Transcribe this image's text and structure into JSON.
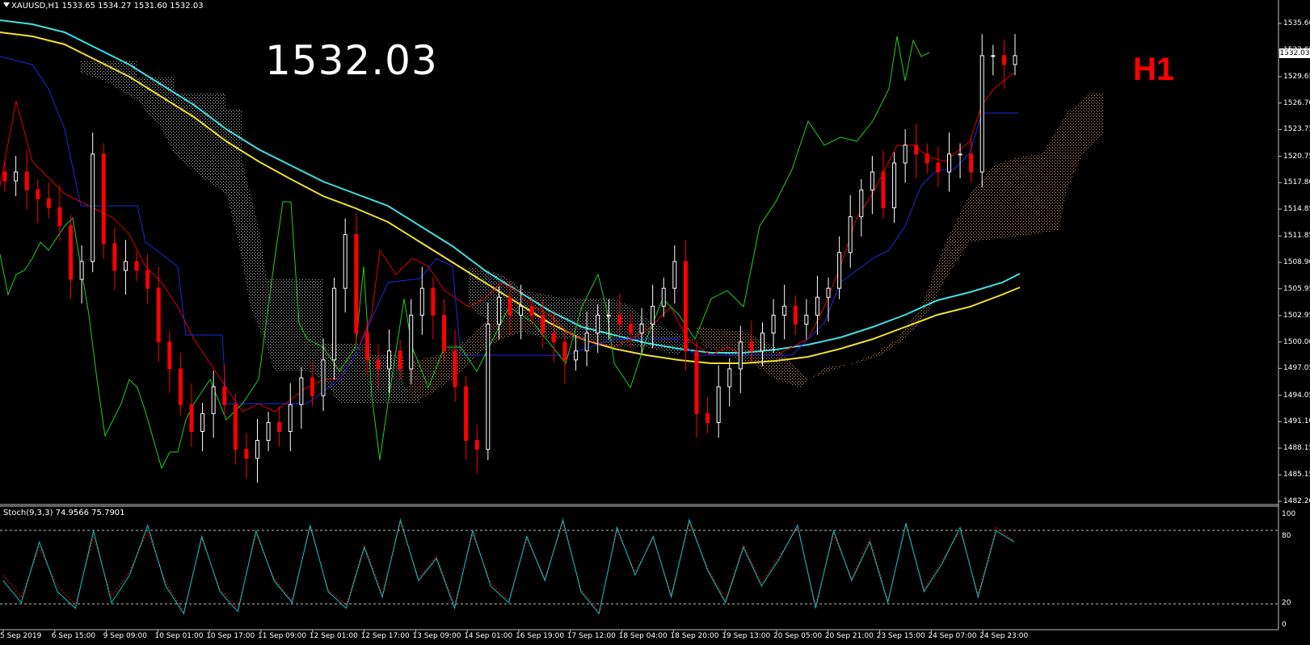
{
  "header": {
    "symbol_line": "XAUUSD,H1  1533.65 1534.27 1531.60 1532.03"
  },
  "overlay": {
    "big_price": "1532.03",
    "timeframe": "H1",
    "timeframe_color": "#ff0000"
  },
  "current_price_tag": "1532.03",
  "price_axis": {
    "labels": [
      "1535.60",
      "1532.65",
      "1529.65",
      "1526.70",
      "1523.75",
      "1520.75",
      "1517.80",
      "1514.85",
      "1511.85",
      "1508.90",
      "1505.95",
      "1502.95",
      "1500.00",
      "1497.05",
      "1494.05",
      "1491.10",
      "1488.15",
      "1485.15",
      "1482.20"
    ],
    "range": [
      1482.2,
      1535.6
    ]
  },
  "stoch": {
    "header": "Stoch(9,3,3) 74.9566 75.7901",
    "levels": [
      "100",
      "80",
      "20",
      "0"
    ],
    "main_color": "#00c8c8",
    "signal_color": "#ff0000"
  },
  "time_axis": {
    "labels": [
      "5 Sep 2019",
      "6 Sep 15:00",
      "9 Sep 09:00",
      "10 Sep 01:00",
      "10 Sep 17:00",
      "11 Sep 09:00",
      "12 Sep 01:00",
      "12 Sep 17:00",
      "13 Sep 09:00",
      "14 Sep 01:00",
      "16 Sep 19:00",
      "17 Sep 12:00",
      "18 Sep 04:00",
      "18 Sep 20:00",
      "19 Sep 13:00",
      "20 Sep 05:00",
      "20 Sep 21:00",
      "23 Sep 15:00",
      "24 Sep 07:00",
      "24 Sep 23:00"
    ]
  },
  "chart_data": {
    "type": "candlestick",
    "title": "",
    "series": [
      {
        "name": "XAUUSD H1 close",
        "values": [
          1518,
          1519,
          1517,
          1516,
          1515,
          1513,
          1507,
          1509,
          1521,
          1511,
          1508,
          1509,
          1508,
          1506,
          1500,
          1497,
          1493,
          1490,
          1492,
          1495,
          1493,
          1488,
          1487,
          1489,
          1491,
          1490,
          1493,
          1496,
          1494,
          1498,
          1506,
          1512,
          1501,
          1498,
          1497,
          1499,
          1497,
          1503,
          1506,
          1503,
          1499,
          1495,
          1489,
          1488,
          1502,
          1505,
          1503,
          1504,
          1503,
          1501,
          1500,
          1498,
          1499,
          1501,
          1503,
          1503,
          1502,
          1501,
          1502,
          1504,
          1506,
          1509,
          1499,
          1492,
          1491,
          1495,
          1497,
          1500,
          1499,
          1501,
          1503,
          1504,
          1502,
          1503,
          1505,
          1506,
          1510,
          1514,
          1517,
          1519,
          1515,
          1520,
          1522,
          1521,
          1520,
          1519,
          1521,
          1521,
          1519,
          1532,
          1532,
          1531,
          1532
        ]
      },
      {
        "name": "Stochastic main",
        "values": [
          40,
          20,
          75,
          30,
          15,
          85,
          20,
          45,
          90,
          35,
          10,
          80,
          30,
          12,
          85,
          40,
          20,
          90,
          30,
          15,
          70,
          25,
          95,
          40,
          60,
          15,
          85,
          35,
          20,
          80,
          40,
          95,
          30,
          10,
          88,
          45,
          80,
          25,
          95,
          50,
          20,
          70,
          35,
          60,
          90,
          15,
          85,
          40,
          75,
          20,
          92,
          30,
          55,
          88,
          25,
          85,
          74.96
        ]
      },
      {
        "name": "Stochastic signal",
        "values": [
          45,
          25,
          70,
          35,
          18,
          80,
          25,
          48,
          85,
          38,
          12,
          78,
          32,
          15,
          82,
          42,
          22,
          88,
          32,
          18,
          72,
          28,
          92,
          42,
          62,
          18,
          82,
          38,
          22,
          78,
          42,
          92,
          32,
          12,
          85,
          48,
          78,
          28,
          92,
          52,
          22,
          72,
          38,
          62,
          88,
          18,
          82,
          42,
          78,
          22,
          90,
          32,
          58,
          85,
          28,
          88,
          75.79
        ]
      }
    ],
    "ylim": [
      1482.2,
      1535.6
    ],
    "grid": false,
    "legend": "none"
  }
}
